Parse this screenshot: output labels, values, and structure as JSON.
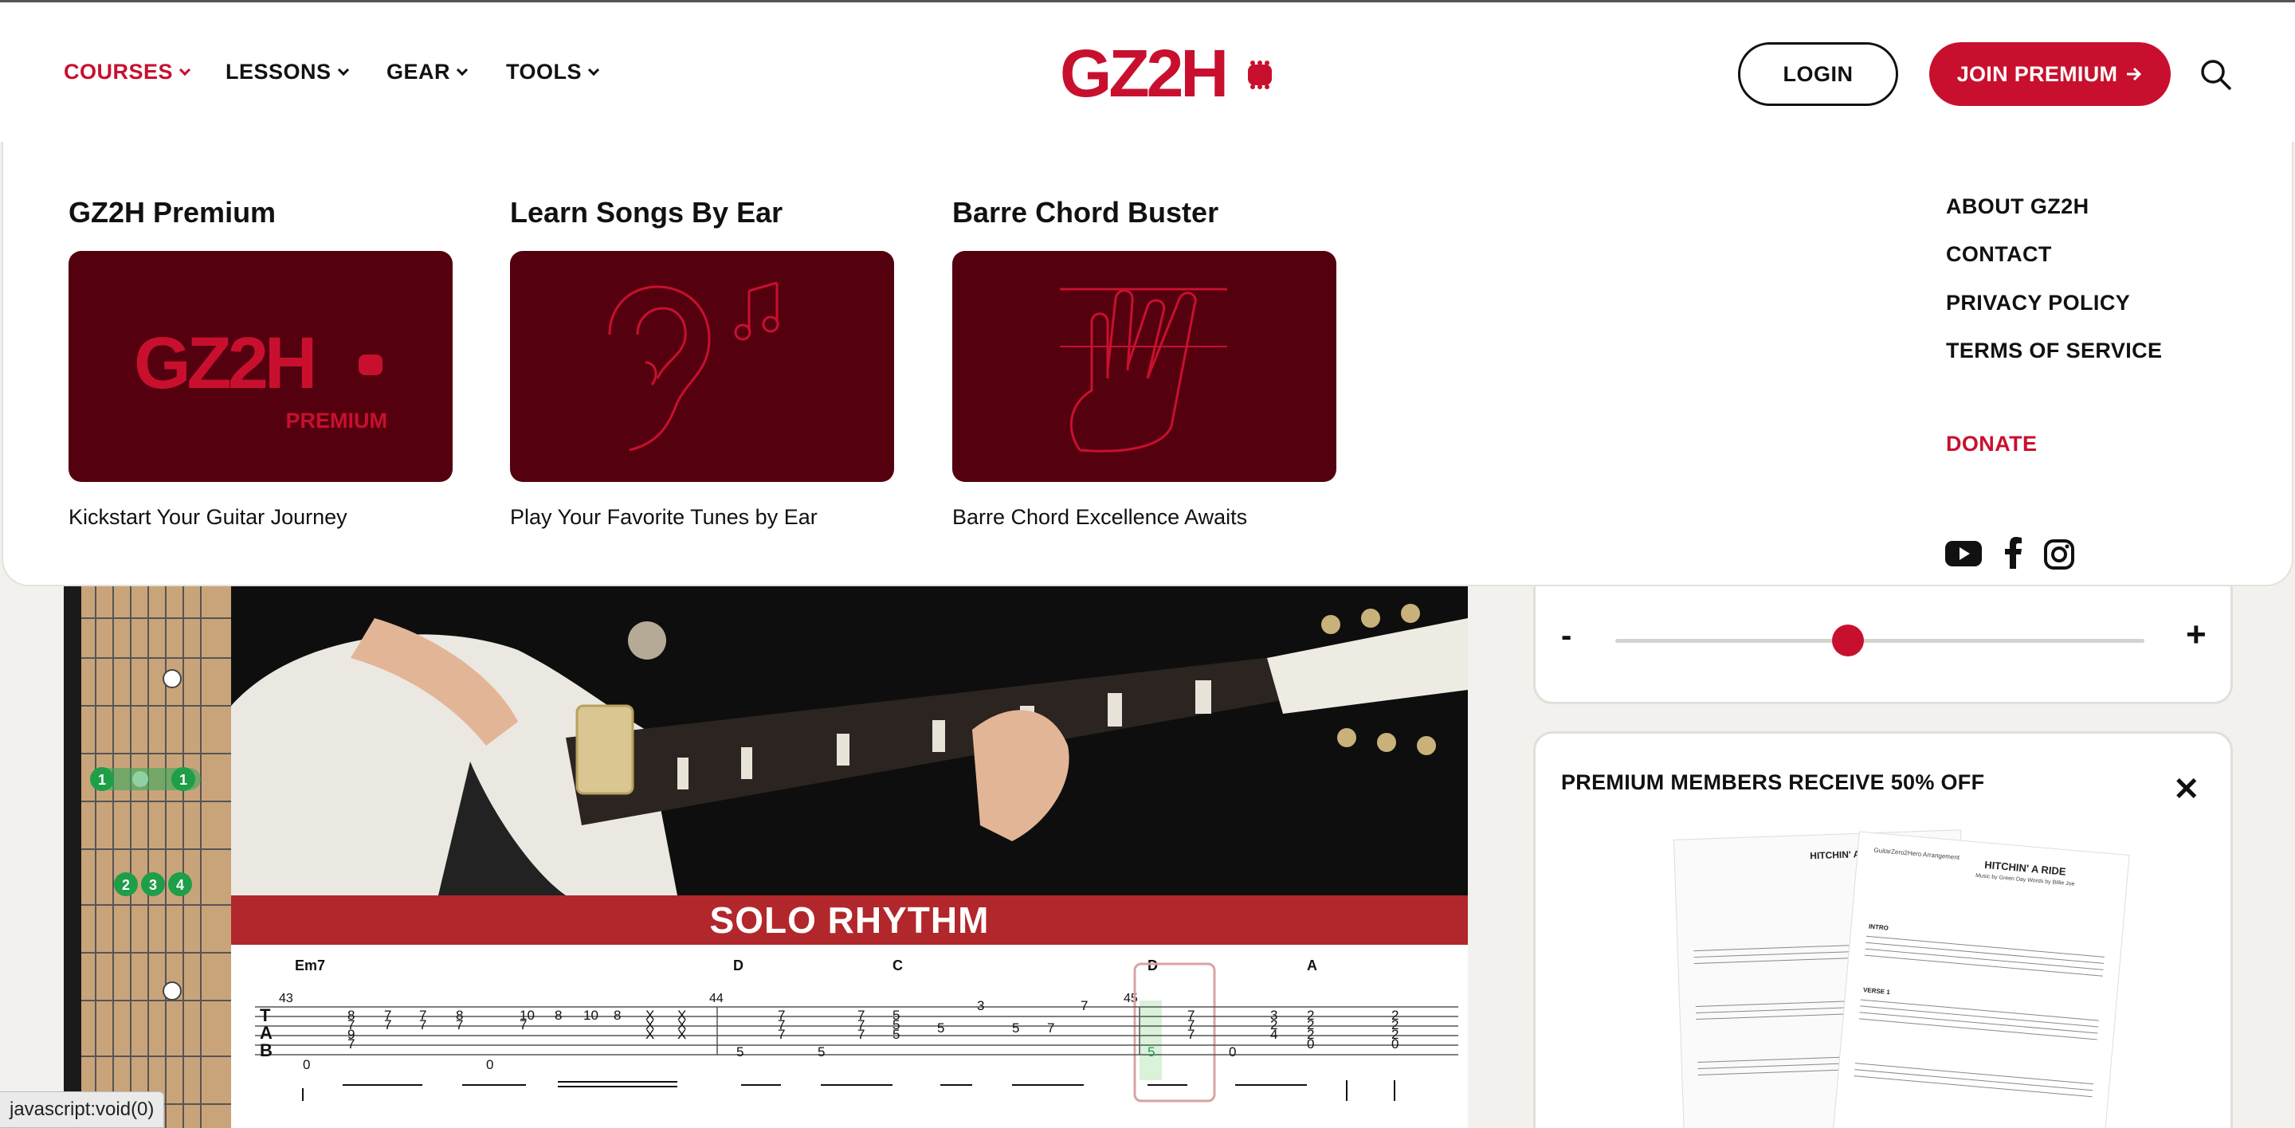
{
  "header": {
    "nav": [
      {
        "label": "COURSES",
        "active": true
      },
      {
        "label": "LESSONS",
        "active": false
      },
      {
        "label": "GEAR",
        "active": false
      },
      {
        "label": "TOOLS",
        "active": false
      }
    ],
    "logo_text": "GZ2H",
    "login_label": "LOGIN",
    "join_label": "JOIN PREMIUM"
  },
  "mega_menu": {
    "cards": [
      {
        "title": "GZ2H Premium",
        "subtitle": "Kickstart Your Guitar Journey",
        "image_text": "GZ2H",
        "image_badge": "PREMIUM"
      },
      {
        "title": "Learn Songs By Ear",
        "subtitle": "Play Your Favorite Tunes by Ear"
      },
      {
        "title": "Barre Chord Buster",
        "subtitle": "Barre Chord Excellence Awaits"
      }
    ],
    "links": [
      "ABOUT GZ2H",
      "CONTACT",
      "PRIVACY POLICY",
      "TERMS OF SERVICE"
    ],
    "donate": "DONATE",
    "social_icons": [
      "youtube-icon",
      "facebook-icon",
      "instagram-icon"
    ]
  },
  "player": {
    "section_label": "SOLO RHYTHM",
    "chords": [
      "Em7",
      "D",
      "C",
      "D",
      "A"
    ],
    "measures": [
      "43",
      "44",
      "45"
    ],
    "tab_labels": [
      "T",
      "A",
      "B"
    ],
    "fingers_top": [
      "1",
      "1"
    ],
    "fingers_bottom": [
      "2",
      "3",
      "4"
    ],
    "speed_minus": "-",
    "speed_plus": "+",
    "speed_level": 0.44
  },
  "promo": {
    "title": "PREMIUM MEMBERS RECEIVE 50% OFF",
    "close": "✕",
    "sheet_title": "HITCHIN' A RIDE",
    "sheet_subtitle": "Music by Green Day Words by Billie Joe",
    "sheet_brand": "GuitarZero2Hero Arrangement",
    "sheet_sections": [
      "INTRO",
      "VERSE 1"
    ]
  },
  "status_bar": "javascript:void(0)",
  "colors": {
    "brand_red": "#c8102e",
    "dark_red": "#55000f"
  }
}
